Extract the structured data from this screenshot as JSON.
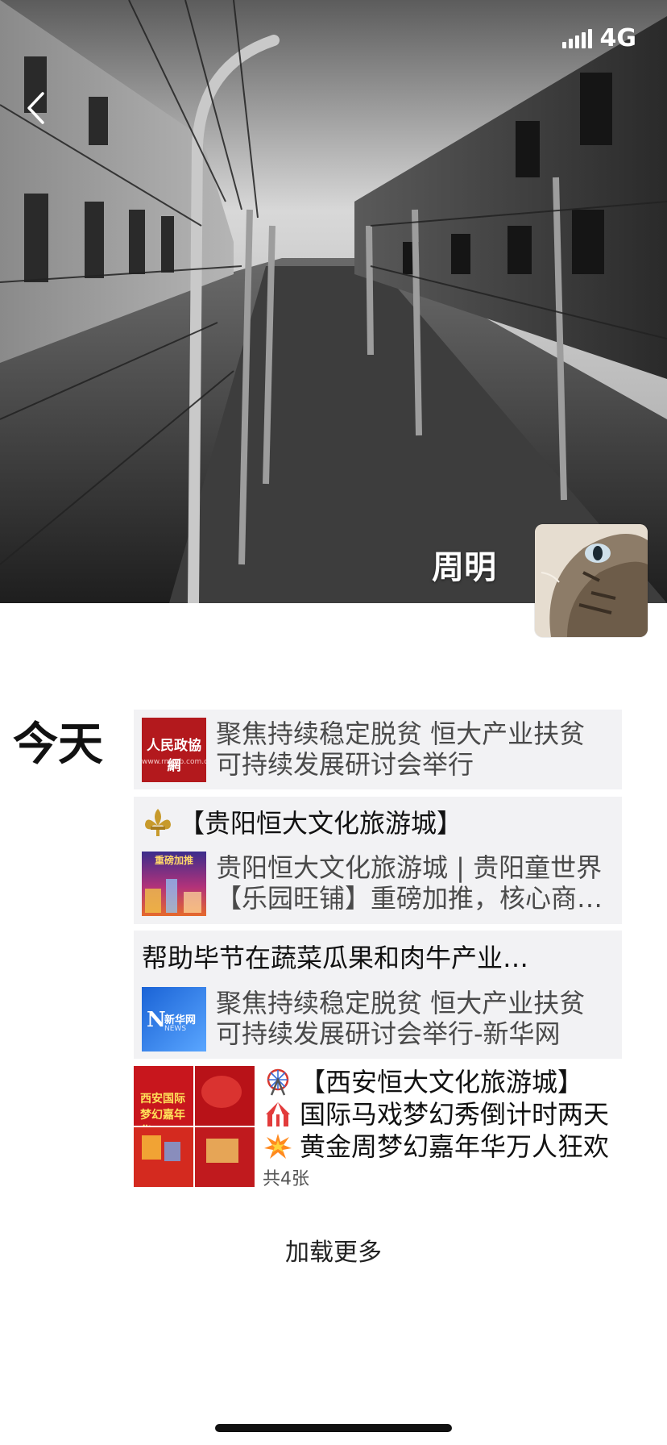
{
  "status_bar": {
    "network": "4G"
  },
  "profile": {
    "name": "周明"
  },
  "feed": {
    "day_label": "今天",
    "items": [
      {
        "type": "link",
        "thumb_label": "人民政協網",
        "thumb_sub": "www.rmzxb.com.cn",
        "title": "聚焦持续稳定脱贫 恒大产业扶贫可持续发展研讨会举行"
      },
      {
        "type": "text-link",
        "text": "【贵阳恒大文化旅游城】",
        "thumb_label": "重磅加推",
        "title": "贵阳恒大文化旅游城 | 贵阳童世界【乐园旺铺】重磅加推，核心商业火热来袭"
      },
      {
        "type": "text-link",
        "text": "帮助毕节在蔬菜瓜果和肉牛产业…",
        "thumb_label": "新华网",
        "thumb_sub": "NEWS",
        "title": "聚焦持续稳定脱贫 恒大产业扶贫可持续发展研讨会举行-新华网"
      },
      {
        "type": "photos",
        "photo_text": "西安国际梦幻嘉年华",
        "lines": [
          "【西安恒大文化旅游城】",
          "国际马戏梦幻秀倒计时两天",
          "黄金周梦幻嘉年华万人狂欢"
        ],
        "photo_count": "共4张"
      }
    ]
  },
  "load_more": "加载更多",
  "colors": {
    "card_bg": "#f2f2f4",
    "link_text": "#4a4a4a"
  }
}
